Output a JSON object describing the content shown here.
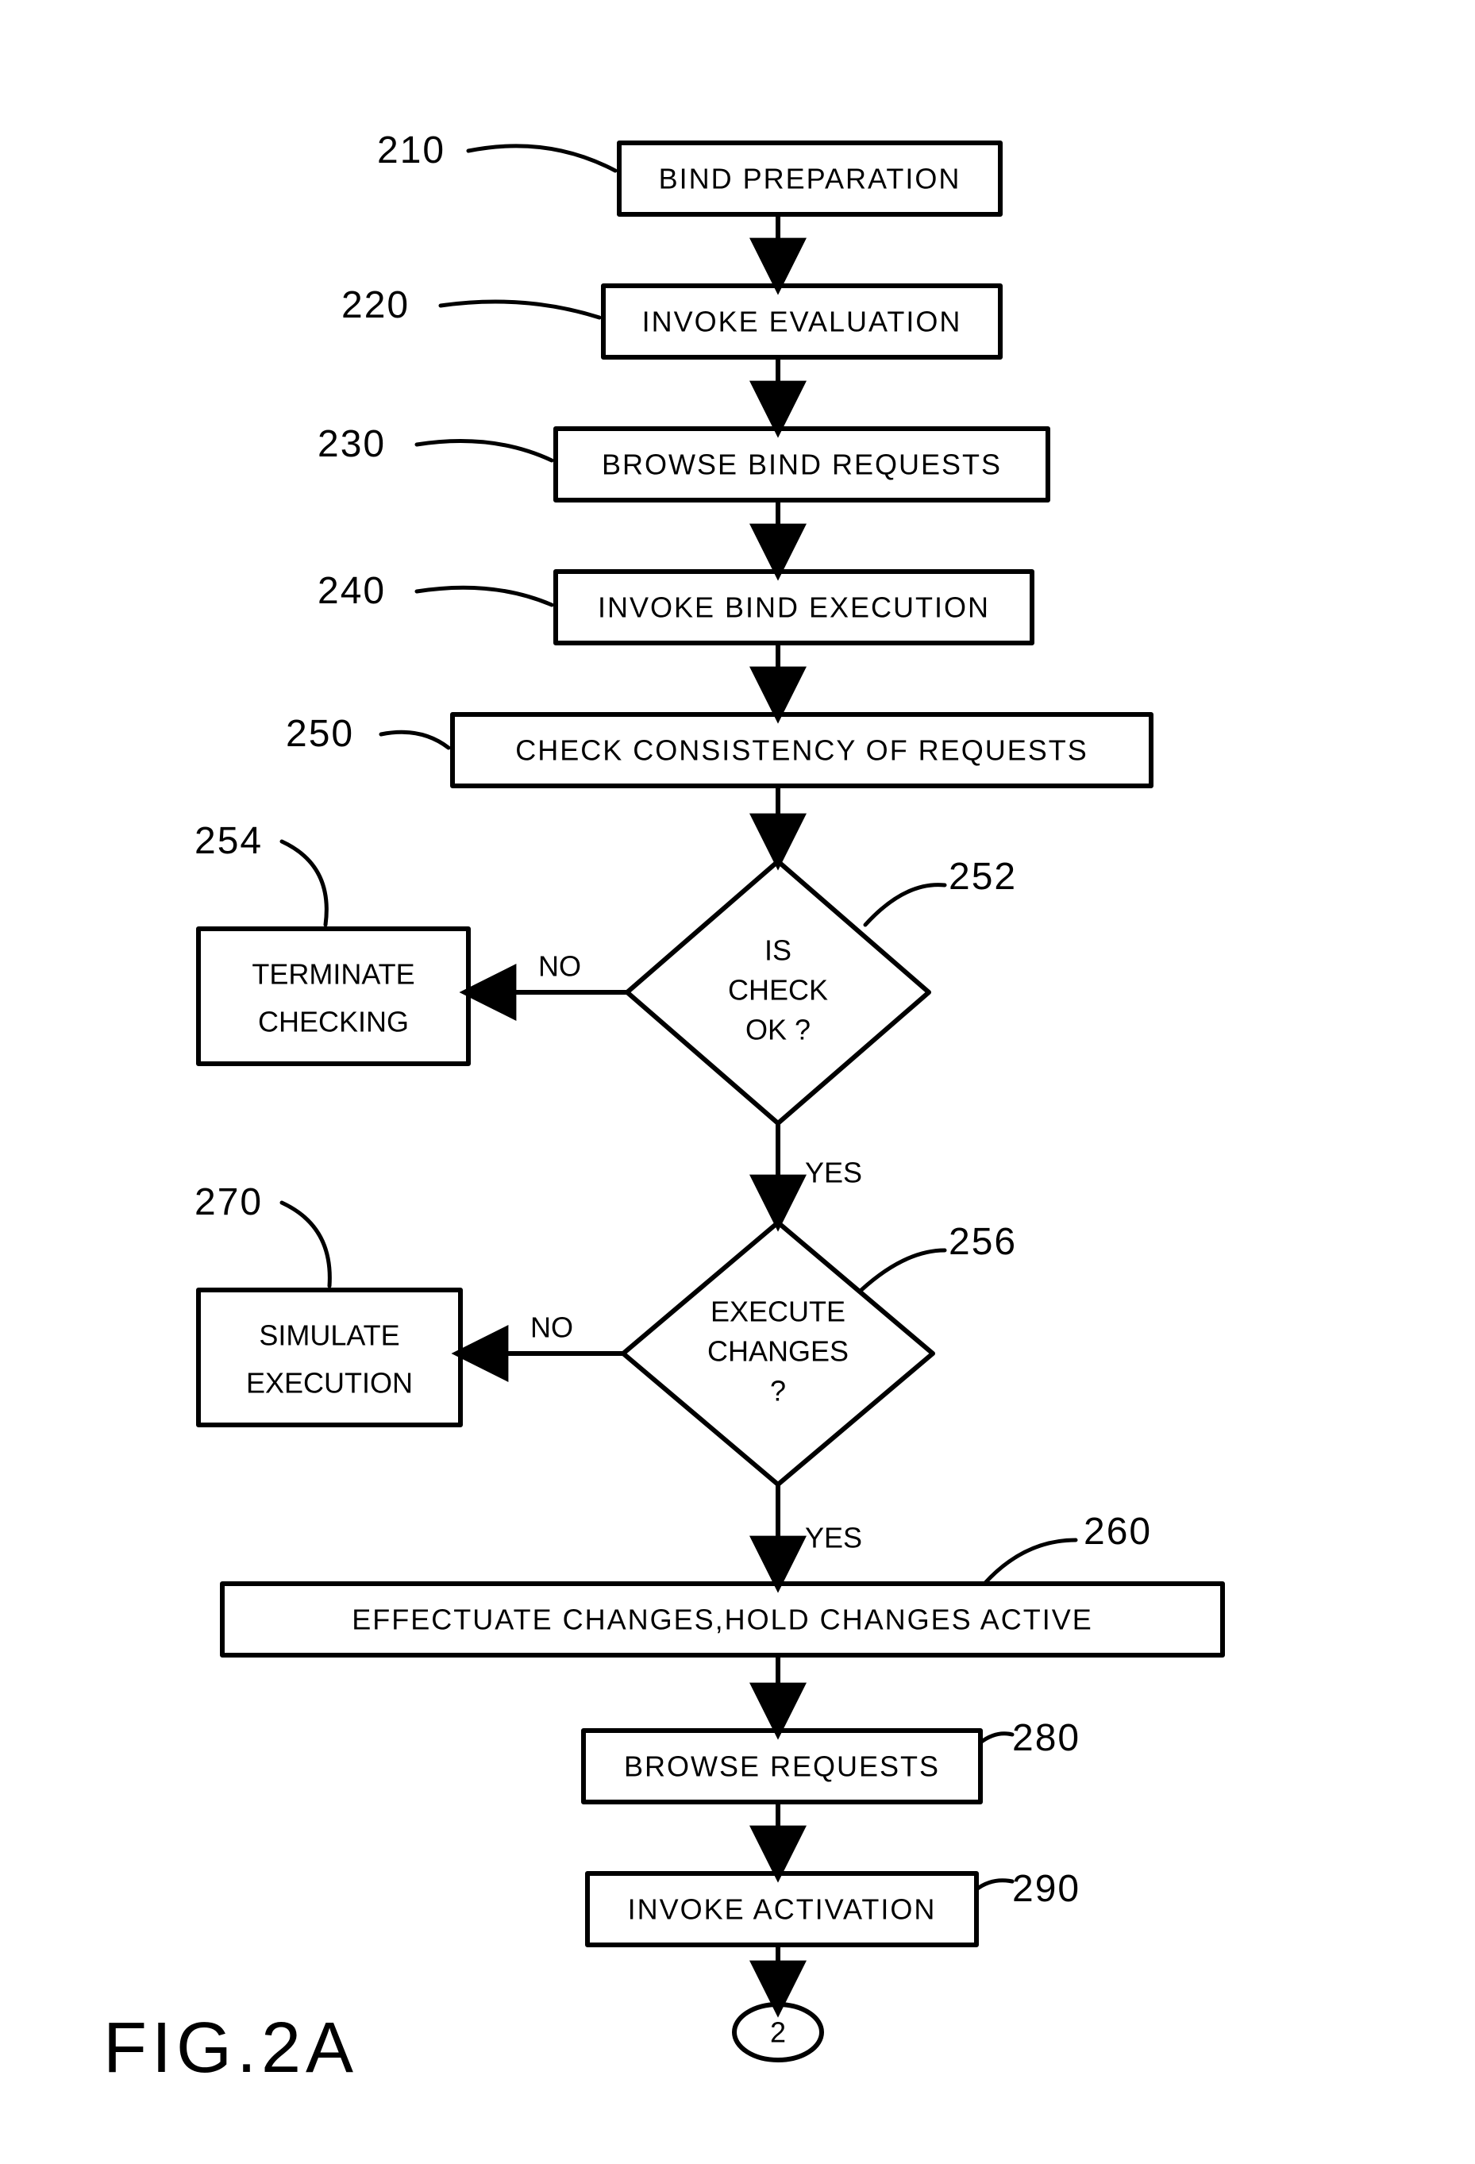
{
  "chart_data": {
    "type": "flowchart",
    "title": "FIG.2A",
    "nodes": [
      {
        "id": "210",
        "ref": "210",
        "type": "process",
        "label": "BIND PREPARATION"
      },
      {
        "id": "220",
        "ref": "220",
        "type": "process",
        "label": "INVOKE EVALUATION"
      },
      {
        "id": "230",
        "ref": "230",
        "type": "process",
        "label": "BROWSE BIND REQUESTS"
      },
      {
        "id": "240",
        "ref": "240",
        "type": "process",
        "label": "INVOKE BIND EXECUTION"
      },
      {
        "id": "250",
        "ref": "250",
        "type": "process",
        "label": "CHECK CONSISTENCY OF REQUESTS"
      },
      {
        "id": "252",
        "ref": "252",
        "type": "decision",
        "label": "IS CHECK OK ?"
      },
      {
        "id": "254",
        "ref": "254",
        "type": "process",
        "label": "TERMINATE CHECKING"
      },
      {
        "id": "256",
        "ref": "256",
        "type": "decision",
        "label": "EXECUTE CHANGES ?"
      },
      {
        "id": "270",
        "ref": "270",
        "type": "process",
        "label": "SIMULATE EXECUTION"
      },
      {
        "id": "260",
        "ref": "260",
        "type": "process",
        "label": "EFFECTUATE CHANGES, HOLD CHANGES ACTIVE"
      },
      {
        "id": "280",
        "ref": "280",
        "type": "process",
        "label": "BROWSE REQUESTS"
      },
      {
        "id": "290",
        "ref": "290",
        "type": "process",
        "label": "INVOKE ACTIVATION"
      },
      {
        "id": "conn2",
        "ref": "2",
        "type": "connector",
        "label": "2"
      }
    ],
    "edges": [
      {
        "from": "210",
        "to": "220",
        "label": ""
      },
      {
        "from": "220",
        "to": "230",
        "label": ""
      },
      {
        "from": "230",
        "to": "240",
        "label": ""
      },
      {
        "from": "240",
        "to": "250",
        "label": ""
      },
      {
        "from": "250",
        "to": "252",
        "label": ""
      },
      {
        "from": "252",
        "to": "254",
        "label": "NO"
      },
      {
        "from": "252",
        "to": "256",
        "label": "YES"
      },
      {
        "from": "256",
        "to": "270",
        "label": "NO"
      },
      {
        "from": "256",
        "to": "260",
        "label": "YES"
      },
      {
        "from": "260",
        "to": "280",
        "label": ""
      },
      {
        "from": "280",
        "to": "290",
        "label": ""
      },
      {
        "from": "290",
        "to": "conn2",
        "label": ""
      }
    ]
  },
  "figLabel": "FIG.2A",
  "steps": {
    "s210": {
      "ref": "210",
      "label": "BIND PREPARATION"
    },
    "s220": {
      "ref": "220",
      "label": "INVOKE EVALUATION"
    },
    "s230": {
      "ref": "230",
      "label": "BROWSE BIND REQUESTS"
    },
    "s240": {
      "ref": "240",
      "label": "INVOKE BIND EXECUTION"
    },
    "s250": {
      "ref": "250",
      "label": "CHECK CONSISTENCY OF REQUESTS"
    },
    "s252": {
      "ref": "252",
      "l1": "IS",
      "l2": "CHECK",
      "l3": "OK ?"
    },
    "s254": {
      "ref": "254",
      "l1": "TERMINATE",
      "l2": "CHECKING"
    },
    "s256": {
      "ref": "256",
      "l1": "EXECUTE",
      "l2": "CHANGES",
      "l3": "?"
    },
    "s270": {
      "ref": "270",
      "l1": "SIMULATE",
      "l2": "EXECUTION"
    },
    "s260": {
      "ref": "260",
      "label": "EFFECTUATE CHANGES,HOLD CHANGES ACTIVE"
    },
    "s280": {
      "ref": "280",
      "label": "BROWSE REQUESTS"
    },
    "s290": {
      "ref": "290",
      "label": "INVOKE ACTIVATION"
    },
    "conn": {
      "label": "2"
    }
  },
  "edgeLabels": {
    "no": "NO",
    "yes": "YES"
  }
}
